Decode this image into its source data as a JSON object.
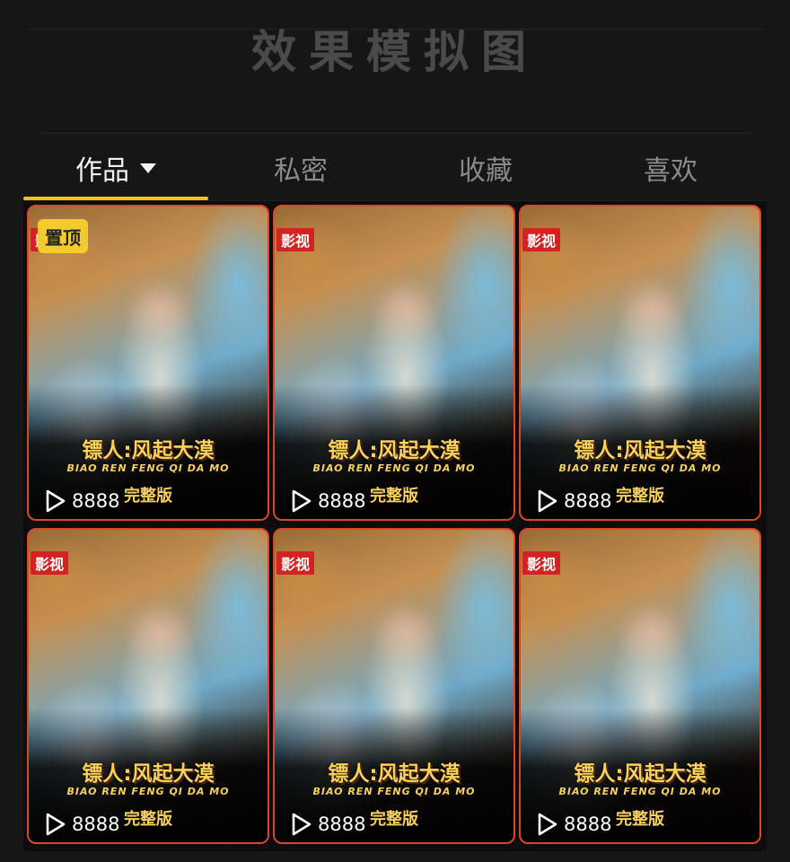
{
  "banner": {
    "title": "效果模拟图"
  },
  "tabs": [
    {
      "label": "作品",
      "active": true,
      "icon": "caret-down-icon"
    },
    {
      "label": "私密",
      "active": false
    },
    {
      "label": "收藏",
      "active": false
    },
    {
      "label": "喜欢",
      "active": false
    }
  ],
  "colors": {
    "accent_underline": "#f2c21a",
    "badge_red": "#d42222",
    "pin_yellow": "#f4cb2c",
    "card_border": "#d8472a",
    "poster_text": "#f7d15a"
  },
  "videos": [
    {
      "pinned": true,
      "pin_label": "置顶",
      "badge": "影视",
      "title": "镖人:风起大漠",
      "pinyin": "BIAO REN FENG QI DA MO",
      "edition": "完整版",
      "plays": "8888",
      "icon": "play-icon"
    },
    {
      "pinned": false,
      "badge": "影视",
      "title": "镖人:风起大漠",
      "pinyin": "BIAO REN FENG QI DA MO",
      "edition": "完整版",
      "plays": "8888",
      "icon": "play-icon"
    },
    {
      "pinned": false,
      "badge": "影视",
      "title": "镖人:风起大漠",
      "pinyin": "BIAO REN FENG QI DA MO",
      "edition": "完整版",
      "plays": "8888",
      "icon": "play-icon"
    },
    {
      "pinned": false,
      "badge": "影视",
      "title": "镖人:风起大漠",
      "pinyin": "BIAO REN FENG QI DA MO",
      "edition": "完整版",
      "plays": "8888",
      "icon": "play-icon"
    },
    {
      "pinned": false,
      "badge": "影视",
      "title": "镖人:风起大漠",
      "pinyin": "BIAO REN FENG QI DA MO",
      "edition": "完整版",
      "plays": "8888",
      "icon": "play-icon"
    },
    {
      "pinned": false,
      "badge": "影视",
      "title": "镖人:风起大漠",
      "pinyin": "BIAO REN FENG QI DA MO",
      "edition": "完整版",
      "plays": "8888",
      "icon": "play-icon"
    }
  ]
}
